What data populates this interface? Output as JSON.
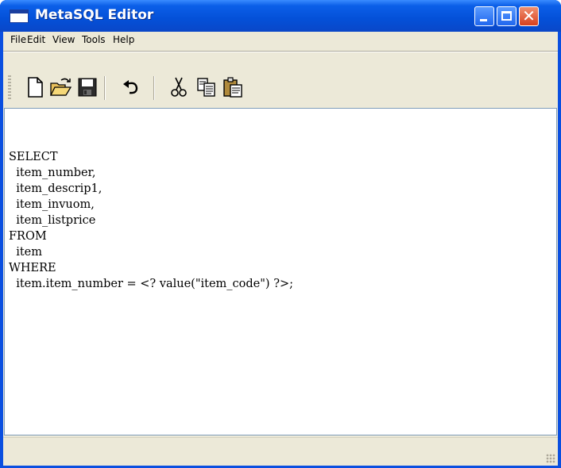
{
  "window": {
    "title": "MetaSQL Editor"
  },
  "title_buttons": {
    "close_glyph": "✕"
  },
  "menu": {
    "items": [
      "File",
      "Edit",
      "View",
      "Tools",
      "Help"
    ]
  },
  "toolbar": {
    "icons": [
      "new-document-icon",
      "open-folder-icon",
      "save-disk-icon",
      "undo-icon",
      "cut-scissors-icon",
      "copy-icon",
      "paste-icon"
    ]
  },
  "editor": {
    "lines": [
      "SELECT",
      "  item_number,",
      "  item_descrip1,",
      "  item_invuom,",
      "  item_listprice",
      "FROM",
      "  item",
      "WHERE",
      "  item.item_number = <? value(\"item_code\") ?>;"
    ]
  },
  "colors": {
    "title_bar": "#0450d8",
    "close_button": "#d9401e",
    "chrome": "#ece9d8"
  }
}
